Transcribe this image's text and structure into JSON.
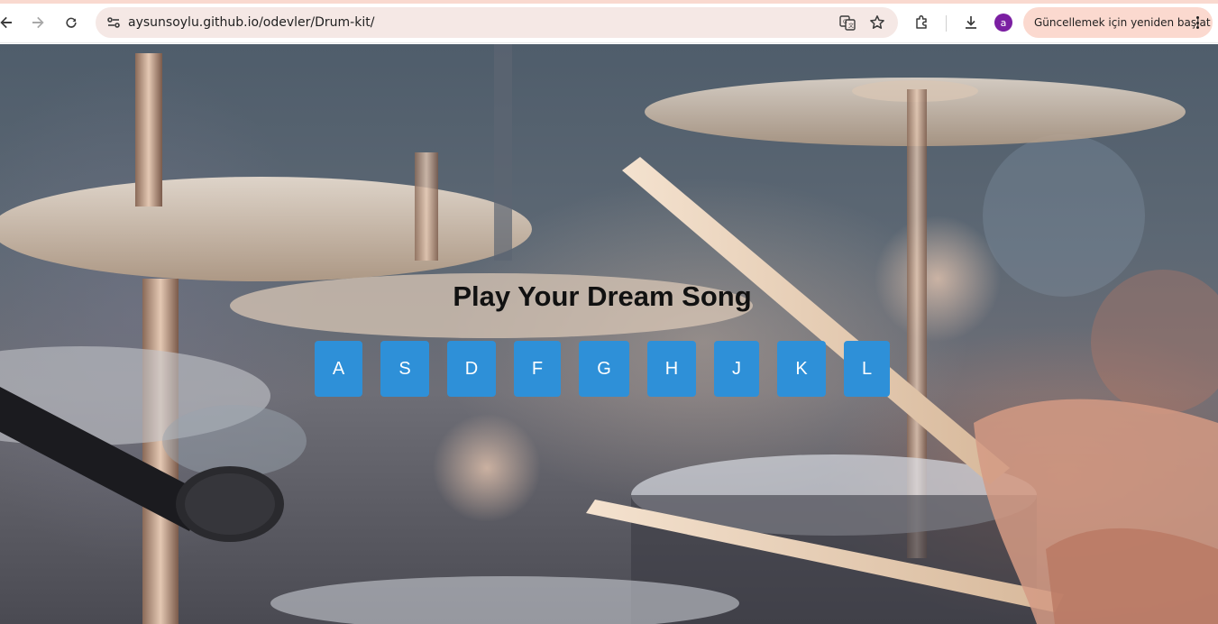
{
  "browser": {
    "url": "aysunsoylu.github.io/odevler/Drum-kit/",
    "profile_initial": "a",
    "update_button_label": "Güncellemek için yeniden başlat",
    "icons": [
      "back-arrow-icon",
      "forward-arrow-icon",
      "reload-icon",
      "site-settings-icon",
      "translate-icon",
      "star-bookmark-icon",
      "extensions-puzzle-icon",
      "download-icon",
      "more-vert-icon"
    ]
  },
  "page": {
    "title": "Play Your Dream Song",
    "background_image": "drum kit with cymbals, drumsticks and microphone",
    "drum_buttons": [
      {
        "key": "A"
      },
      {
        "key": "S"
      },
      {
        "key": "D"
      },
      {
        "key": "F"
      },
      {
        "key": "G"
      },
      {
        "key": "H"
      },
      {
        "key": "J"
      },
      {
        "key": "K"
      },
      {
        "key": "L"
      }
    ],
    "colors": {
      "button_bg": "#2e90d8",
      "button_text": "#ffffff",
      "title_text": "#111111"
    }
  }
}
